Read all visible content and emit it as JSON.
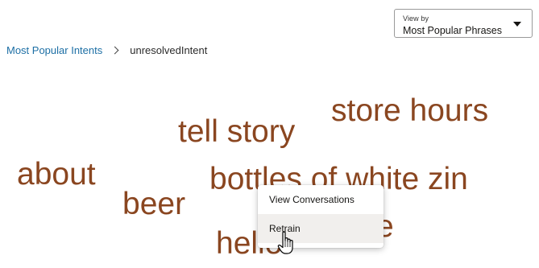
{
  "view_by": {
    "label": "View by",
    "selected": "Most Popular Phrases"
  },
  "breadcrumb": {
    "parent": "Most Popular Intents",
    "current": "unresolvedIntent"
  },
  "word_cloud": {
    "color": "#8a4620",
    "words": [
      {
        "id": "store-hours",
        "text": "store hours"
      },
      {
        "id": "tell-story",
        "text": "tell story"
      },
      {
        "id": "about",
        "text": "about"
      },
      {
        "id": "bottles-of-white-zin",
        "text": "bottles of white zin"
      },
      {
        "id": "beer",
        "text": "beer"
      },
      {
        "id": "hello",
        "text": "hello"
      },
      {
        "id": "partial-word",
        "text": "e"
      }
    ]
  },
  "context_menu": {
    "items": [
      {
        "label": "View Conversations"
      },
      {
        "label": "Retrain",
        "hovered": true
      }
    ]
  },
  "colors": {
    "link": "#1d6fa5",
    "word": "#8a4620",
    "menu_hover": "#f1efed"
  }
}
